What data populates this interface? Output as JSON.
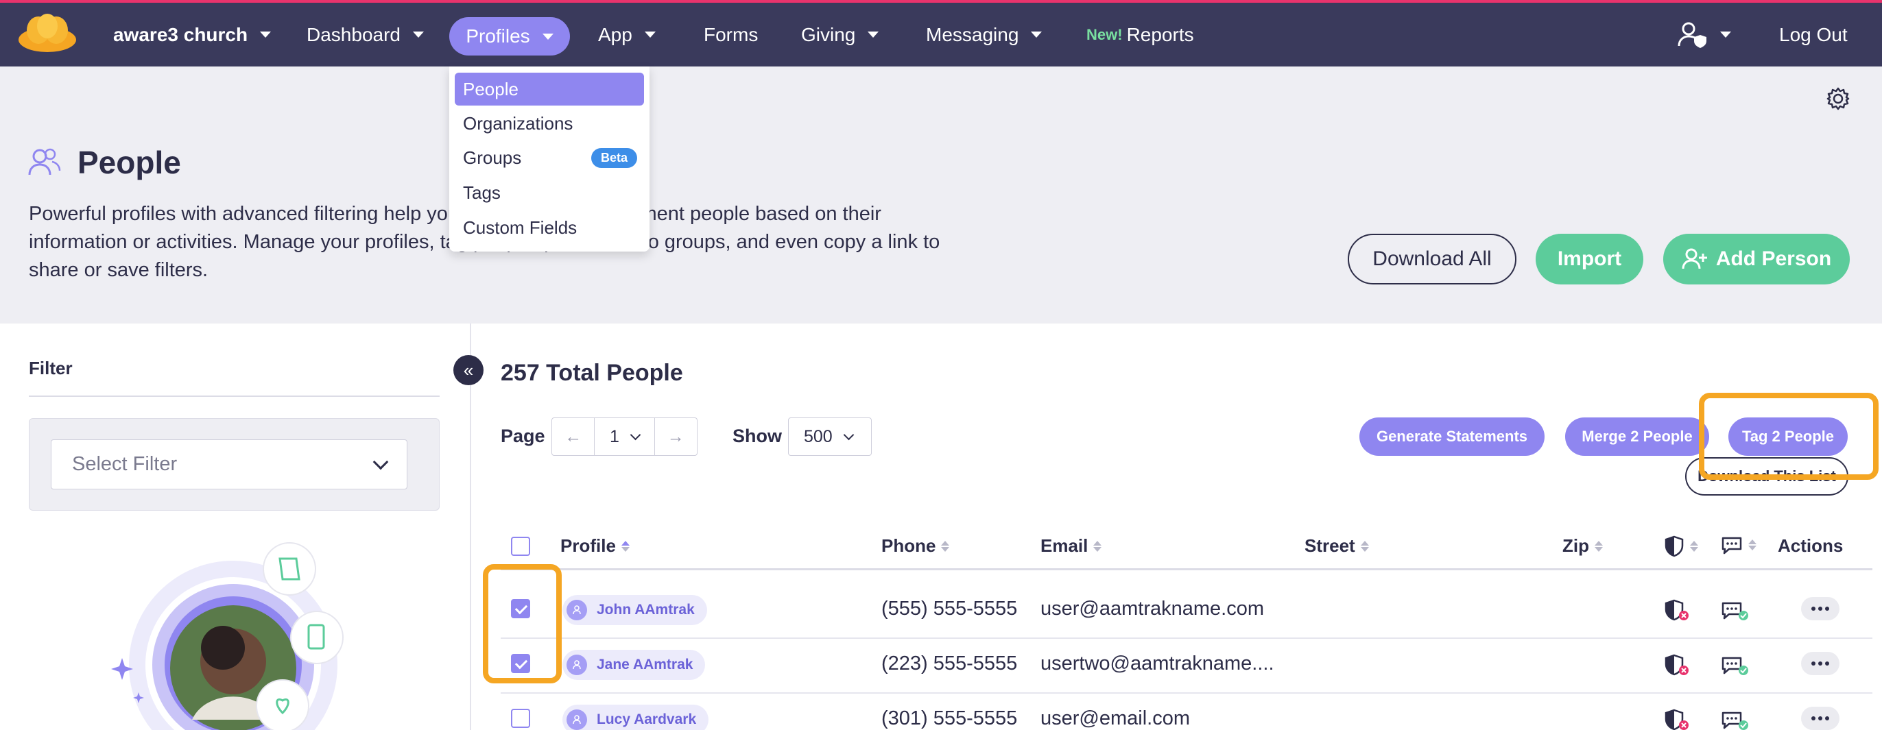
{
  "nav": {
    "org": "aware3 church",
    "dashboard": "Dashboard",
    "profiles": "Profiles",
    "app": "App",
    "forms": "Forms",
    "giving": "Giving",
    "messaging": "Messaging",
    "reports_badge": "New!",
    "reports": "Reports",
    "logout": "Log Out"
  },
  "profiles_menu": {
    "items": [
      "People",
      "Organizations",
      "Groups",
      "Tags",
      "Custom Fields"
    ],
    "active": "People",
    "groups_badge": "Beta"
  },
  "header": {
    "title": "People",
    "description": "Powerful profiles with advanced filtering help you understand and segment people based on their information or activities. Manage your profiles, tag people, put them into groups, and even copy a link to share or save filters.",
    "download_all": "Download All",
    "import": "Import",
    "add_person": "Add Person"
  },
  "filter": {
    "label": "Filter",
    "placeholder": "Select Filter"
  },
  "list": {
    "total": "257 Total People",
    "page_label": "Page",
    "page": "1",
    "show_label": "Show",
    "show": "500",
    "generate_statements": "Generate Statements",
    "merge": "Merge 2 People",
    "tag": "Tag 2 People",
    "download_list": "Download This List"
  },
  "table": {
    "columns": [
      "Profile",
      "Phone",
      "Email",
      "Street",
      "Zip",
      "Actions"
    ],
    "rows": [
      {
        "name": "John AAmtrak",
        "phone": "(555) 555-5555",
        "email": "user@aamtrakname.com",
        "checked": true
      },
      {
        "name": "Jane AAmtrak",
        "phone": "(223) 555-5555",
        "email": "usertwo@aamtrakname....",
        "checked": true
      },
      {
        "name": "Lucy Aardvark",
        "phone": "(301) 555-5555",
        "email": "user@email.com",
        "checked": false
      }
    ]
  },
  "colors": {
    "topbar": "#3a3a5c",
    "accent": "#8f86f0",
    "green": "#5ccc9b",
    "highlight": "#f5a623"
  }
}
